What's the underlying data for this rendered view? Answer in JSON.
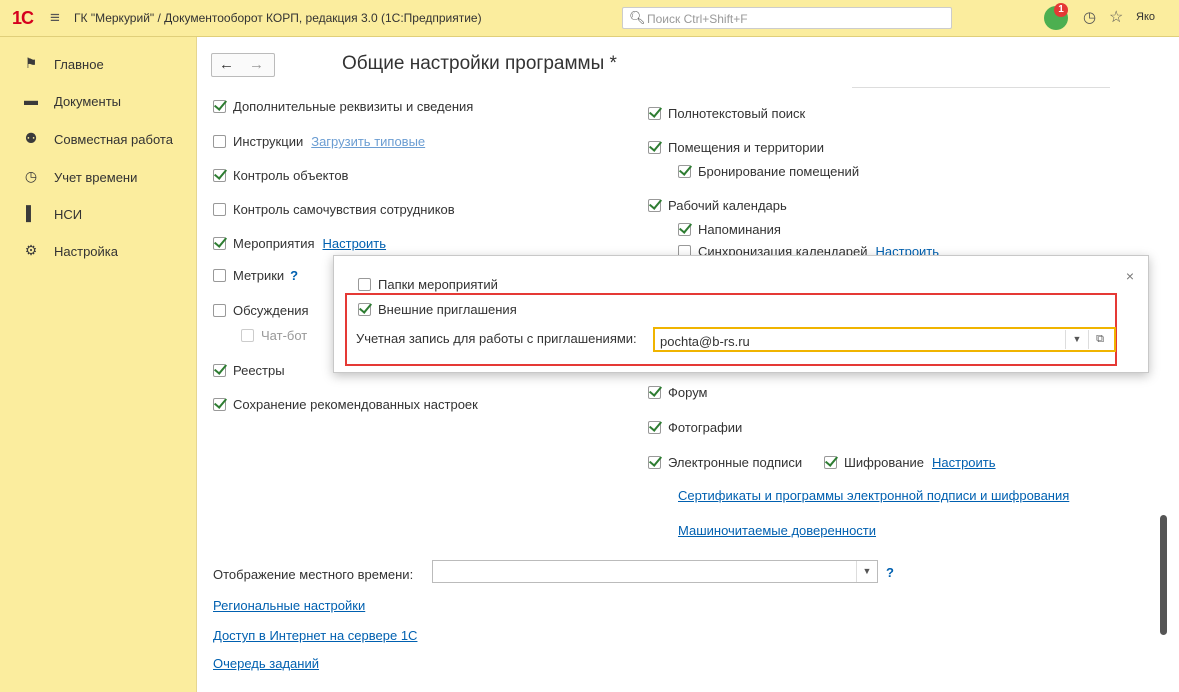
{
  "app": {
    "logo": "1С",
    "title": "ГК \"Меркурий\" / Документооборот КОРП, редакция 3.0  (1С:Предприятие)",
    "search_placeholder": "Поиск Ctrl+Shift+F",
    "notification_count": "1",
    "user": "Яко"
  },
  "sidebar": {
    "items": [
      {
        "label": "Главное",
        "icon": "flag-icon"
      },
      {
        "label": "Документы",
        "icon": "documents-icon"
      },
      {
        "label": "Совместная работа",
        "icon": "people-icon"
      },
      {
        "label": "Учет времени",
        "icon": "clock-icon"
      },
      {
        "label": "НСИ",
        "icon": "book-icon"
      },
      {
        "label": "Настройка",
        "icon": "gear-icon"
      }
    ]
  },
  "page": {
    "title": "Общие настройки программы *"
  },
  "left": {
    "extra_details": {
      "label": "Дополнительные реквизиты и сведения",
      "checked": true
    },
    "instructions": {
      "label": "Инструкции",
      "checked": false,
      "link": "Загрузить типовые"
    },
    "object_control": {
      "label": "Контроль объектов",
      "checked": true
    },
    "wellbeing": {
      "label": "Контроль самочувствия сотрудников",
      "checked": false
    },
    "events": {
      "label": "Мероприятия",
      "checked": true,
      "link": "Настроить"
    },
    "metrics": {
      "label": "Метрики",
      "checked": false,
      "help": "?"
    },
    "discussions": {
      "label": "Обсуждения",
      "checked": false
    },
    "chatbot": {
      "label": "Чат-бот",
      "checked": false
    },
    "registers": {
      "label": "Реестры",
      "checked": true
    },
    "saved_settings": {
      "label": "Сохранение рекомендованных настроек",
      "checked": true
    }
  },
  "right": {
    "fulltext": {
      "label": "Полнотекстовый поиск",
      "checked": true
    },
    "premises": {
      "label": "Помещения и территории",
      "checked": true
    },
    "booking": {
      "label": "Бронирование помещений",
      "checked": true
    },
    "calendar": {
      "label": "Рабочий календарь",
      "checked": true
    },
    "reminders": {
      "label": "Напоминания",
      "checked": true
    },
    "calendar_sync": {
      "label": "Синхронизация календарей",
      "link": "Настроить"
    },
    "forum": {
      "label": "Форум",
      "checked": true
    },
    "photos": {
      "label": "Фотографии",
      "checked": true
    },
    "esign": {
      "label": "Электронные подписи",
      "checked": true
    },
    "encryption": {
      "label": "Шифрование",
      "checked": true,
      "link": "Настроить"
    },
    "certs_link": "Сертификаты и программы электронной подписи и шифрования",
    "poa_link": "Машиночитаемые доверенности"
  },
  "bottom": {
    "local_time_label": "Отображение местного времени:",
    "local_time_value": "",
    "help": "?",
    "links": [
      "Региональные настройки",
      "Доступ в Интернет на сервере 1С",
      "Очередь заданий"
    ]
  },
  "popup": {
    "folders": {
      "label": "Папки мероприятий",
      "checked": false
    },
    "invites": {
      "label": "Внешние приглашения",
      "checked": true
    },
    "account_label": "Учетная запись для работы с приглашениями:",
    "account_value": "pochta@b-rs.ru",
    "close": "×"
  },
  "colors": {
    "panel": "#fbed9e",
    "link": "#0060b0",
    "highlight": "#e53935",
    "focus": "#f0b400"
  }
}
